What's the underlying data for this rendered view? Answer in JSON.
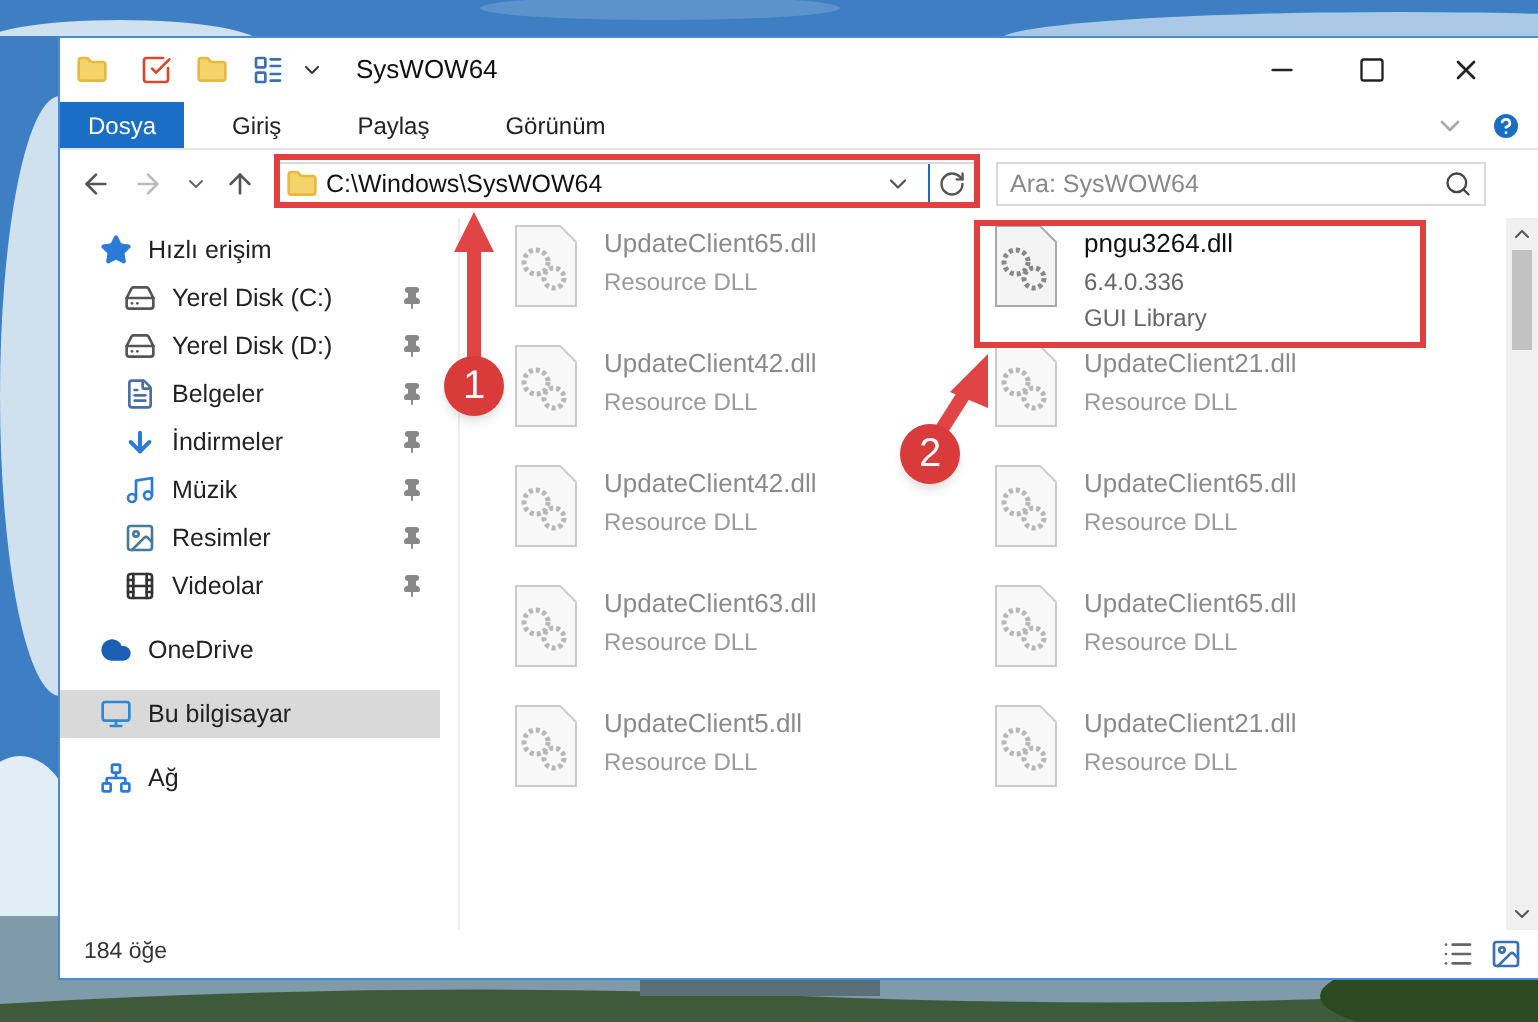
{
  "window": {
    "title": "SysWOW64"
  },
  "ribbon_tabs": [
    {
      "label": "Dosya",
      "selected": true
    },
    {
      "label": "Giriş",
      "selected": false
    },
    {
      "label": "Paylaş",
      "selected": false
    },
    {
      "label": "Görünüm",
      "selected": false
    }
  ],
  "address_bar": {
    "path": "C:\\Windows\\SysWOW64"
  },
  "search": {
    "placeholder": "Ara: SysWOW64"
  },
  "sidebar": {
    "items": [
      {
        "label": "Hızlı erişim",
        "kind": "star",
        "selected": false,
        "children": [
          {
            "label": "Yerel Disk (C:)",
            "kind": "disk",
            "pinned": true,
            "selected": false
          },
          {
            "label": "Yerel Disk (D:)",
            "kind": "disk",
            "pinned": true,
            "selected": false
          },
          {
            "label": "Belgeler",
            "kind": "docs",
            "pinned": true,
            "selected": false
          },
          {
            "label": "İndirmeler",
            "kind": "download",
            "pinned": true,
            "selected": false
          },
          {
            "label": "Müzik",
            "kind": "music",
            "pinned": true,
            "selected": false
          },
          {
            "label": "Resimler",
            "kind": "pictures",
            "pinned": true,
            "selected": false
          },
          {
            "label": "Videolar",
            "kind": "videos",
            "pinned": true,
            "selected": false
          }
        ]
      },
      {
        "label": "OneDrive",
        "kind": "cloud",
        "selected": false
      },
      {
        "label": "Bu bilgisayar",
        "kind": "pc",
        "selected": true
      },
      {
        "label": "Ağ",
        "kind": "network",
        "selected": false
      }
    ]
  },
  "files": [
    {
      "name": "UpdateClient65.dll",
      "details": [
        "Resource DLL"
      ],
      "blurred": true
    },
    {
      "name": "pngu3264.dll",
      "details": [
        "6.4.0.336",
        "GUI Library"
      ],
      "blurred": false
    },
    {
      "name": "UpdateClient42.dll",
      "details": [
        "Resource DLL"
      ],
      "blurred": true
    },
    {
      "name": "UpdateClient21.dll",
      "details": [
        "Resource DLL"
      ],
      "blurred": true
    },
    {
      "name": "UpdateClient42.dll",
      "details": [
        "Resource DLL"
      ],
      "blurred": true
    },
    {
      "name": "UpdateClient65.dll",
      "details": [
        "Resource DLL"
      ],
      "blurred": true
    },
    {
      "name": "UpdateClient63.dll",
      "details": [
        "Resource DLL"
      ],
      "blurred": true
    },
    {
      "name": "UpdateClient65.dll",
      "details": [
        "Resource DLL"
      ],
      "blurred": true
    },
    {
      "name": "UpdateClient5.dll",
      "details": [
        "Resource DLL"
      ],
      "blurred": true
    },
    {
      "name": "UpdateClient21.dll",
      "details": [
        "Resource DLL"
      ],
      "blurred": true
    }
  ],
  "status_bar": {
    "count": "184 öğe"
  },
  "annotations": [
    {
      "label": "1"
    },
    {
      "label": "2"
    }
  ]
}
